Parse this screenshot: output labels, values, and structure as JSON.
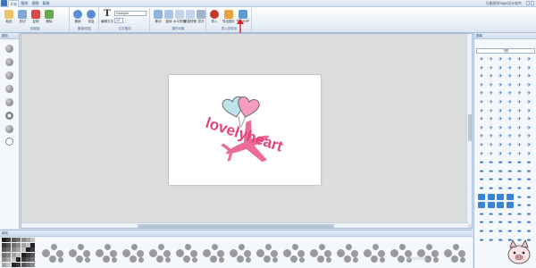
{
  "menu": {
    "tabs": [
      "开始",
      "图形",
      "视图",
      "帮助"
    ],
    "active_tab": "开始",
    "app_title": "万能图形logo设计软件"
  },
  "ribbon": {
    "groups": [
      {
        "label": "剪贴板",
        "buttons": [
          "粘贴",
          "剪切",
          "复制",
          "删除"
        ]
      },
      {
        "label": "撤销/恢复",
        "buttons": [
          "撤销",
          "恢复"
        ]
      },
      {
        "label": "文字格式",
        "buttons": [
          "编辑文字"
        ],
        "font_name": "Georgia",
        "font_size": "20"
      },
      {
        "label": "操作对象",
        "buttons": [
          "移动",
          "旋转",
          "水平镜像",
          "垂直镜像",
          "层次"
        ]
      },
      {
        "label": "导入及导出",
        "buttons": [
          "导入",
          "导出图片",
          "导出EMF"
        ]
      }
    ]
  },
  "left_panel": {
    "title": "图形"
  },
  "right_panel": {
    "title": "图库",
    "category": "飞机"
  },
  "bottom_panel": {
    "title": "填充"
  },
  "canvas": {
    "logo_text": "lovelyheart"
  },
  "watermark": "Windows",
  "colors": {
    "heart_left": "#bfe3ea",
    "heart_right": "#f59ac0",
    "logo_text": "#e6427a",
    "plane": "#ec6b99"
  }
}
